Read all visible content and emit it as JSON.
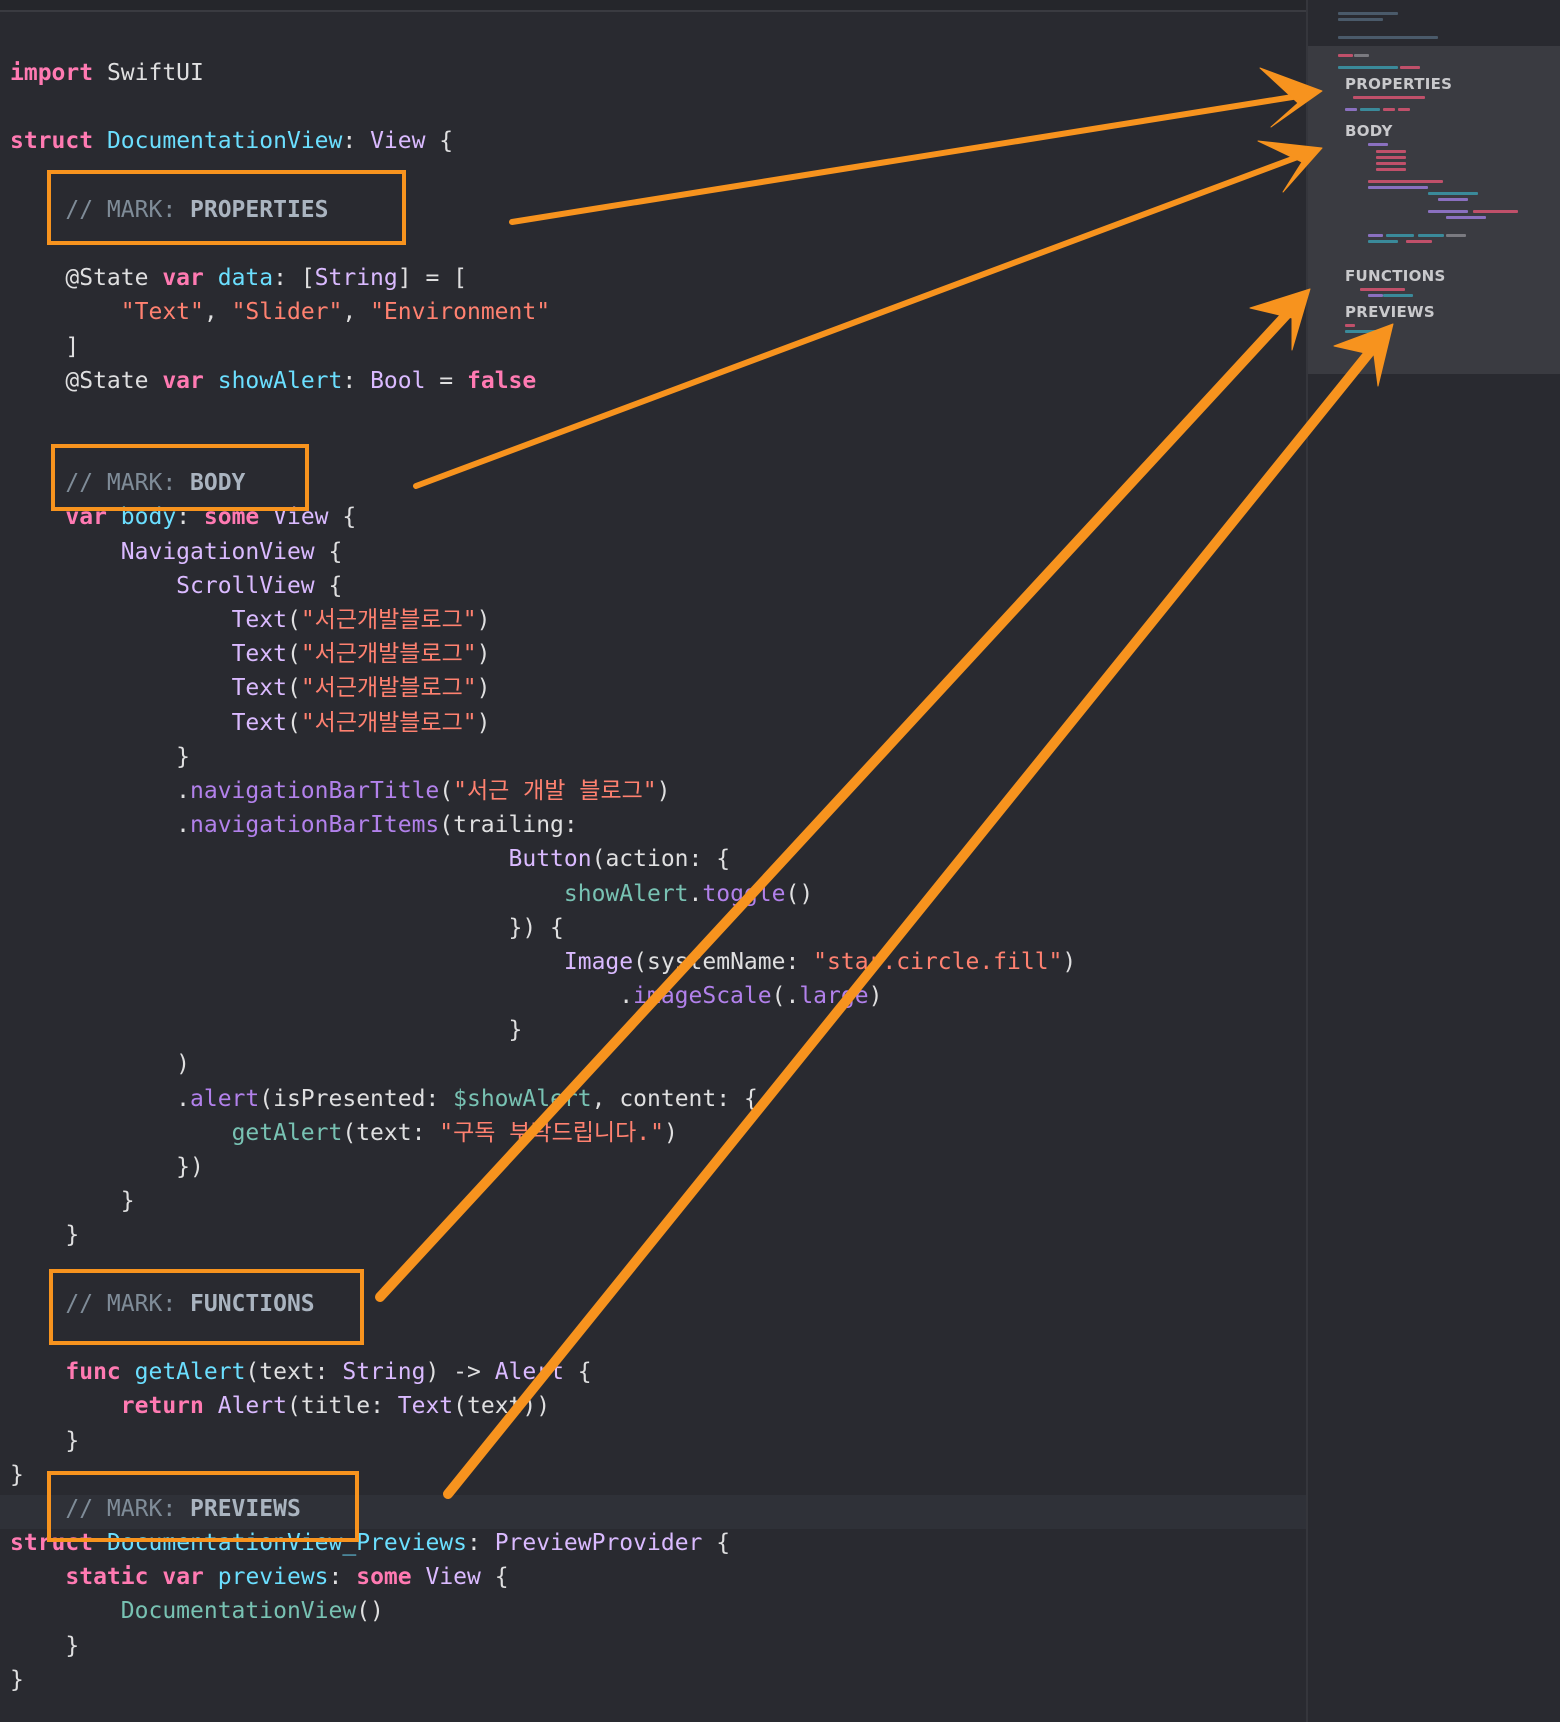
{
  "editor": {
    "lines": [
      [
        {
          "t": "import",
          "c": "kw"
        },
        {
          "t": " SwiftUI",
          "c": "plain"
        }
      ],
      [],
      [
        {
          "t": "struct",
          "c": "kw"
        },
        {
          "t": " ",
          "c": "plain"
        },
        {
          "t": "DocumentationView",
          "c": "decl"
        },
        {
          "t": ": ",
          "c": "plain"
        },
        {
          "t": "View",
          "c": "ty"
        },
        {
          "t": " {",
          "c": "plain"
        }
      ],
      [],
      [
        {
          "t": "    // MARK: ",
          "c": "cm"
        },
        {
          "t": "PROPERTIES",
          "c": "mk"
        }
      ],
      [],
      [
        {
          "t": "    @State ",
          "c": "plain"
        },
        {
          "t": "var",
          "c": "kw"
        },
        {
          "t": " ",
          "c": "plain"
        },
        {
          "t": "data",
          "c": "decl"
        },
        {
          "t": ": [",
          "c": "plain"
        },
        {
          "t": "String",
          "c": "ty"
        },
        {
          "t": "] = [",
          "c": "plain"
        }
      ],
      [
        {
          "t": "        ",
          "c": "plain"
        },
        {
          "t": "\"Text\"",
          "c": "str"
        },
        {
          "t": ", ",
          "c": "plain"
        },
        {
          "t": "\"Slider\"",
          "c": "str"
        },
        {
          "t": ", ",
          "c": "plain"
        },
        {
          "t": "\"Environment\"",
          "c": "str"
        }
      ],
      [
        {
          "t": "    ]",
          "c": "plain"
        }
      ],
      [
        {
          "t": "    @State ",
          "c": "plain"
        },
        {
          "t": "var",
          "c": "kw"
        },
        {
          "t": " ",
          "c": "plain"
        },
        {
          "t": "showAlert",
          "c": "decl"
        },
        {
          "t": ": ",
          "c": "plain"
        },
        {
          "t": "Bool",
          "c": "ty"
        },
        {
          "t": " = ",
          "c": "plain"
        },
        {
          "t": "false",
          "c": "kw"
        }
      ],
      [],
      [],
      [
        {
          "t": "    // MARK: ",
          "c": "cm"
        },
        {
          "t": "BODY",
          "c": "mk"
        }
      ],
      [
        {
          "t": "    ",
          "c": "plain"
        },
        {
          "t": "var",
          "c": "kw"
        },
        {
          "t": " ",
          "c": "plain"
        },
        {
          "t": "body",
          "c": "decl"
        },
        {
          "t": ": ",
          "c": "plain"
        },
        {
          "t": "some",
          "c": "kw"
        },
        {
          "t": " ",
          "c": "plain"
        },
        {
          "t": "View",
          "c": "ty"
        },
        {
          "t": " {",
          "c": "plain"
        }
      ],
      [
        {
          "t": "        ",
          "c": "plain"
        },
        {
          "t": "NavigationView",
          "c": "ty"
        },
        {
          "t": " {",
          "c": "plain"
        }
      ],
      [
        {
          "t": "            ",
          "c": "plain"
        },
        {
          "t": "ScrollView",
          "c": "ty"
        },
        {
          "t": " {",
          "c": "plain"
        }
      ],
      [
        {
          "t": "                ",
          "c": "plain"
        },
        {
          "t": "Text",
          "c": "ty"
        },
        {
          "t": "(",
          "c": "plain"
        },
        {
          "t": "\"서근개발블로그\"",
          "c": "str"
        },
        {
          "t": ")",
          "c": "plain"
        }
      ],
      [
        {
          "t": "                ",
          "c": "plain"
        },
        {
          "t": "Text",
          "c": "ty"
        },
        {
          "t": "(",
          "c": "plain"
        },
        {
          "t": "\"서근개발블로그\"",
          "c": "str"
        },
        {
          "t": ")",
          "c": "plain"
        }
      ],
      [
        {
          "t": "                ",
          "c": "plain"
        },
        {
          "t": "Text",
          "c": "ty"
        },
        {
          "t": "(",
          "c": "plain"
        },
        {
          "t": "\"서근개발블로그\"",
          "c": "str"
        },
        {
          "t": ")",
          "c": "plain"
        }
      ],
      [
        {
          "t": "                ",
          "c": "plain"
        },
        {
          "t": "Text",
          "c": "ty"
        },
        {
          "t": "(",
          "c": "plain"
        },
        {
          "t": "\"서근개발블로그\"",
          "c": "str"
        },
        {
          "t": ")",
          "c": "plain"
        }
      ],
      [
        {
          "t": "            }",
          "c": "plain"
        }
      ],
      [
        {
          "t": "            .",
          "c": "plain"
        },
        {
          "t": "navigationBarTitle",
          "c": "fn"
        },
        {
          "t": "(",
          "c": "plain"
        },
        {
          "t": "\"서근 개발 블로그\"",
          "c": "str"
        },
        {
          "t": ")",
          "c": "plain"
        }
      ],
      [
        {
          "t": "            .",
          "c": "plain"
        },
        {
          "t": "navigationBarItems",
          "c": "fn"
        },
        {
          "t": "(trailing:",
          "c": "plain"
        }
      ],
      [
        {
          "t": "                                    ",
          "c": "plain"
        },
        {
          "t": "Button",
          "c": "ty"
        },
        {
          "t": "(action: {",
          "c": "plain"
        }
      ],
      [
        {
          "t": "                                        ",
          "c": "plain"
        },
        {
          "t": "showAlert",
          "c": "proj"
        },
        {
          "t": ".",
          "c": "plain"
        },
        {
          "t": "toggle",
          "c": "fn"
        },
        {
          "t": "()",
          "c": "plain"
        }
      ],
      [
        {
          "t": "                                    }) {",
          "c": "plain"
        }
      ],
      [
        {
          "t": "                                        ",
          "c": "plain"
        },
        {
          "t": "Image",
          "c": "ty"
        },
        {
          "t": "(systemName: ",
          "c": "plain"
        },
        {
          "t": "\"star.circle.fill\"",
          "c": "str"
        },
        {
          "t": ")",
          "c": "plain"
        }
      ],
      [
        {
          "t": "                                            .",
          "c": "plain"
        },
        {
          "t": "imageScale",
          "c": "fn"
        },
        {
          "t": "(.",
          "c": "plain"
        },
        {
          "t": "large",
          "c": "fn"
        },
        {
          "t": ")",
          "c": "plain"
        }
      ],
      [
        {
          "t": "                                    }",
          "c": "plain"
        }
      ],
      [
        {
          "t": "            )",
          "c": "plain"
        }
      ],
      [
        {
          "t": "            .",
          "c": "plain"
        },
        {
          "t": "alert",
          "c": "fn"
        },
        {
          "t": "(isPresented: ",
          "c": "plain"
        },
        {
          "t": "$showAlert",
          "c": "proj"
        },
        {
          "t": ", content: {",
          "c": "plain"
        }
      ],
      [
        {
          "t": "                ",
          "c": "plain"
        },
        {
          "t": "getAlert",
          "c": "proj"
        },
        {
          "t": "(text: ",
          "c": "plain"
        },
        {
          "t": "\"구독 부탁드립니다.\"",
          "c": "str"
        },
        {
          "t": ")",
          "c": "plain"
        }
      ],
      [
        {
          "t": "            })",
          "c": "plain"
        }
      ],
      [
        {
          "t": "        }",
          "c": "plain"
        }
      ],
      [
        {
          "t": "    }",
          "c": "plain"
        }
      ],
      [],
      [
        {
          "t": "    // MARK: ",
          "c": "cm"
        },
        {
          "t": "FUNCTIONS",
          "c": "mk"
        }
      ],
      [],
      [
        {
          "t": "    ",
          "c": "plain"
        },
        {
          "t": "func",
          "c": "kw"
        },
        {
          "t": " ",
          "c": "plain"
        },
        {
          "t": "getAlert",
          "c": "decl"
        },
        {
          "t": "(text: ",
          "c": "plain"
        },
        {
          "t": "String",
          "c": "ty"
        },
        {
          "t": ") -> ",
          "c": "plain"
        },
        {
          "t": "Alert",
          "c": "ty"
        },
        {
          "t": " {",
          "c": "plain"
        }
      ],
      [
        {
          "t": "        ",
          "c": "plain"
        },
        {
          "t": "return",
          "c": "kw"
        },
        {
          "t": " ",
          "c": "plain"
        },
        {
          "t": "Alert",
          "c": "ty"
        },
        {
          "t": "(title: ",
          "c": "plain"
        },
        {
          "t": "Text",
          "c": "ty"
        },
        {
          "t": "(text))",
          "c": "plain"
        }
      ],
      [
        {
          "t": "    }",
          "c": "plain"
        }
      ],
      [
        {
          "t": "}",
          "c": "plain"
        }
      ],
      [
        {
          "t": "    // MARK: ",
          "c": "cm"
        },
        {
          "t": "PREVIEWS",
          "c": "mk"
        }
      ],
      [
        {
          "t": "struct",
          "c": "kw"
        },
        {
          "t": " ",
          "c": "plain"
        },
        {
          "t": "DocumentationView_Previews",
          "c": "decl"
        },
        {
          "t": ": ",
          "c": "plain"
        },
        {
          "t": "PreviewProvider",
          "c": "ty"
        },
        {
          "t": " {",
          "c": "plain"
        }
      ],
      [
        {
          "t": "    ",
          "c": "plain"
        },
        {
          "t": "static",
          "c": "kw"
        },
        {
          "t": " ",
          "c": "plain"
        },
        {
          "t": "var",
          "c": "kw"
        },
        {
          "t": " ",
          "c": "plain"
        },
        {
          "t": "previews",
          "c": "decl"
        },
        {
          "t": ": ",
          "c": "plain"
        },
        {
          "t": "some",
          "c": "kw"
        },
        {
          "t": " ",
          "c": "plain"
        },
        {
          "t": "View",
          "c": "ty"
        },
        {
          "t": " {",
          "c": "plain"
        }
      ],
      [
        {
          "t": "        ",
          "c": "plain"
        },
        {
          "t": "DocumentationView",
          "c": "proj"
        },
        {
          "t": "()",
          "c": "plain"
        }
      ],
      [
        {
          "t": "    }",
          "c": "plain"
        }
      ],
      [
        {
          "t": "}",
          "c": "plain"
        }
      ]
    ]
  },
  "minimap": {
    "properties": "PROPERTIES",
    "body": "BODY",
    "functions": "FUNCTIONS",
    "previews": "PREVIEWS"
  },
  "colors": {
    "accent": "#f7931e",
    "background": "#292a30",
    "keyword": "#ff7ab2",
    "type": "#dabaff",
    "string": "#ff8170",
    "comment": "#7f8c98"
  }
}
